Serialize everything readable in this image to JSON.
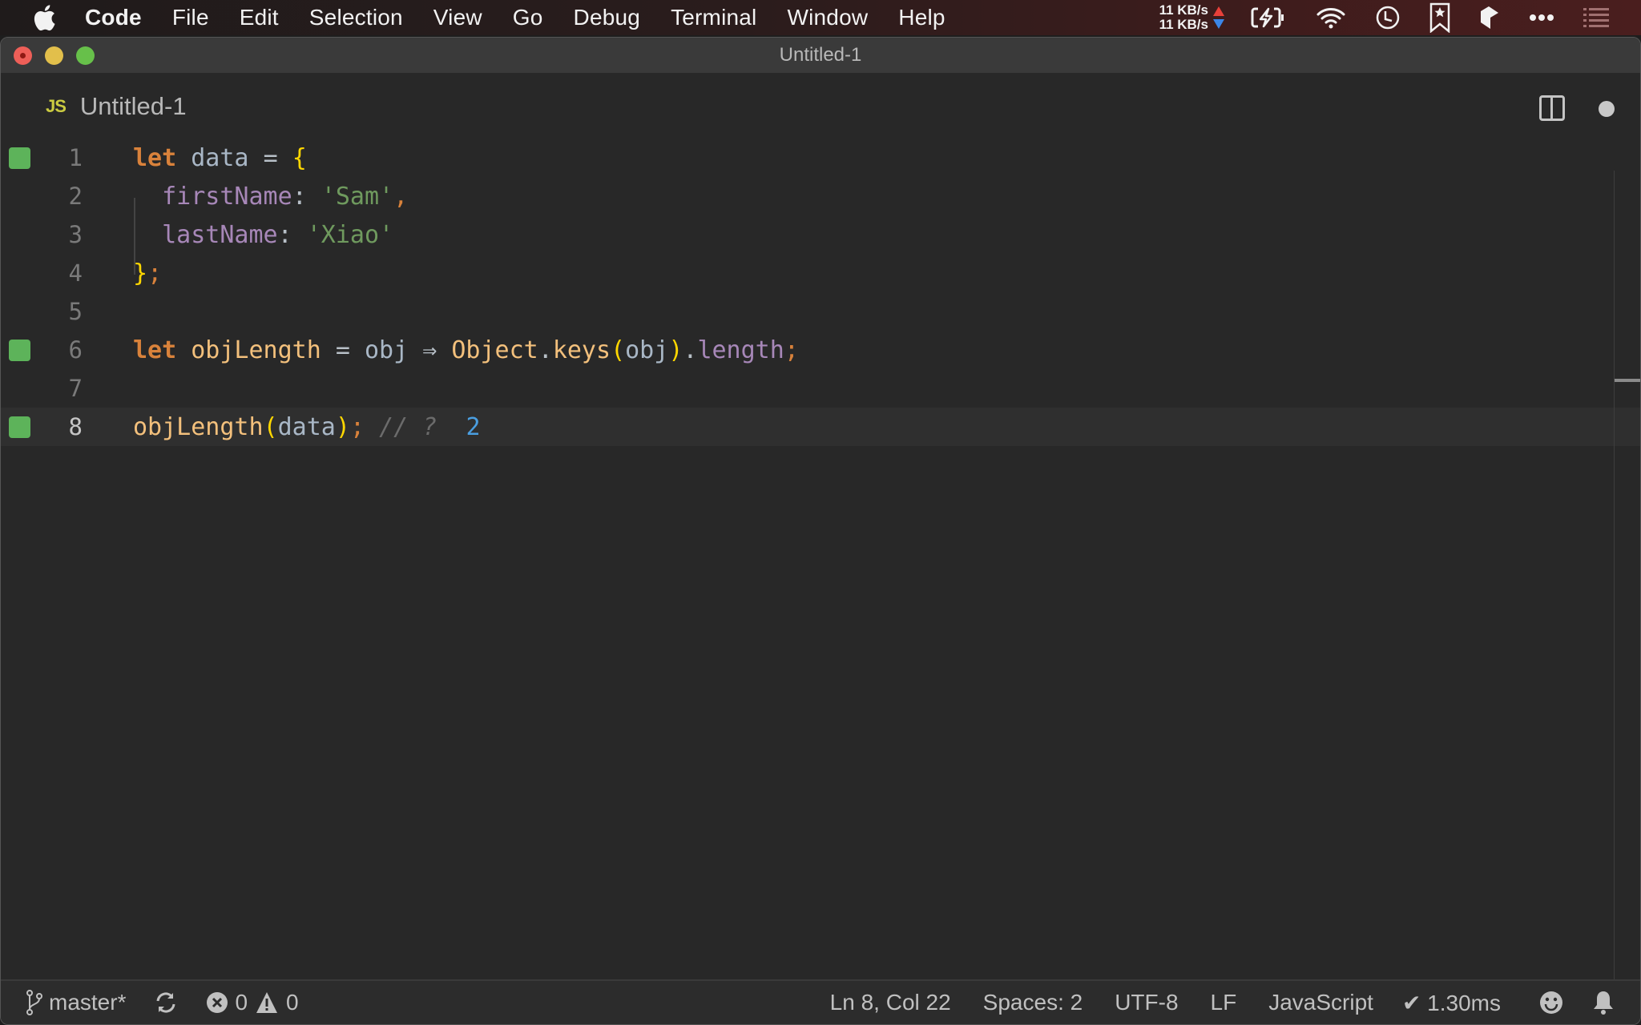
{
  "menubar": {
    "app_name": "Code",
    "items": [
      "File",
      "Edit",
      "Selection",
      "View",
      "Go",
      "Debug",
      "Terminal",
      "Window",
      "Help"
    ],
    "net_up": "11 KB/s",
    "net_down": "11 KB/s",
    "status_icons": [
      "battery-charging-icon",
      "wifi-icon",
      "clock-icon",
      "bookmark-star-icon",
      "app-icon",
      "more-icon",
      "list-icon"
    ]
  },
  "window": {
    "title": "Untitled-1"
  },
  "tab": {
    "icon_label": "JS",
    "name": "Untitled-1",
    "dirty": true
  },
  "editor": {
    "current_line": 8,
    "lines": [
      {
        "n": "1",
        "marked": true
      },
      {
        "n": "2",
        "marked": false
      },
      {
        "n": "3",
        "marked": false
      },
      {
        "n": "4",
        "marked": false
      },
      {
        "n": "5",
        "marked": false
      },
      {
        "n": "6",
        "marked": true
      },
      {
        "n": "7",
        "marked": false
      },
      {
        "n": "8",
        "marked": true
      }
    ],
    "code": {
      "l1": {
        "kw": "let",
        "name": "data",
        "eq": "=",
        "brace": "{"
      },
      "l2": {
        "prop": "firstName",
        "colon": ":",
        "str": "'Sam'",
        "comma": ","
      },
      "l3": {
        "prop": "lastName",
        "colon": ":",
        "str": "'Xiao'"
      },
      "l4": {
        "brace": "}",
        "semi": ";"
      },
      "l6": {
        "kw": "let",
        "name": "objLength",
        "eq": "=",
        "param": "obj",
        "arrow": "⇒",
        "obj": "Object",
        "dot1": ".",
        "method": "keys",
        "lp": "(",
        "arg": "obj",
        "rp": ")",
        "dot2": ".",
        "prop": "length",
        "semi": ";"
      },
      "l8": {
        "fn": "objLength",
        "lp": "(",
        "arg": "data",
        "rp": ")",
        "semi": ";",
        "comment": "// ?",
        "result": "2"
      }
    }
  },
  "statusbar": {
    "branch": "master*",
    "errors": "0",
    "warnings": "0",
    "cursor": "Ln 8, Col 22",
    "indent": "Spaces: 2",
    "encoding": "UTF-8",
    "eol": "LF",
    "language": "JavaScript",
    "timing": "✔ 1.30ms"
  }
}
